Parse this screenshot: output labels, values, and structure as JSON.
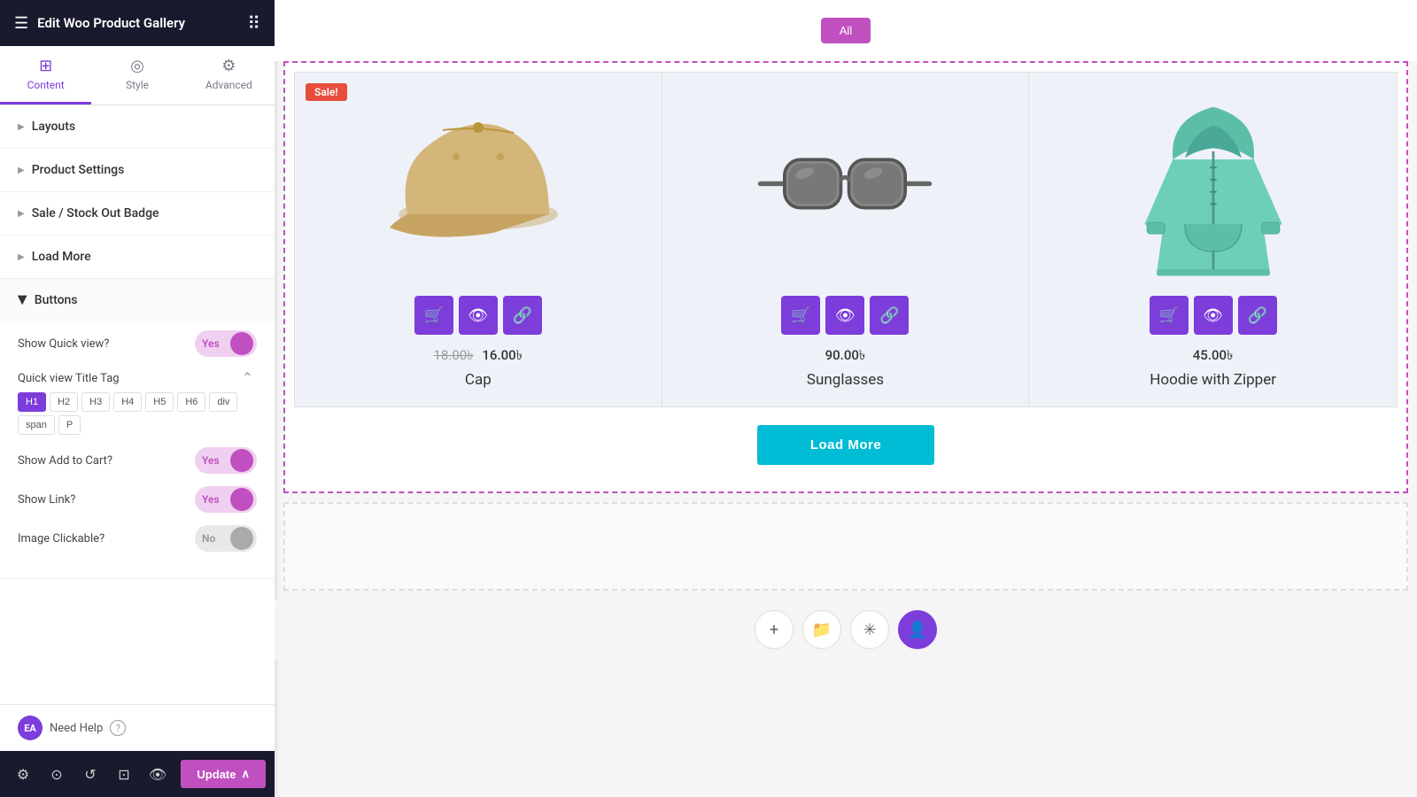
{
  "header": {
    "title": "Edit Woo Product Gallery",
    "hamburger": "☰",
    "dots": "⋮⋮⋮"
  },
  "tabs": [
    {
      "id": "content",
      "label": "Content",
      "icon": "⊞",
      "active": true
    },
    {
      "id": "style",
      "label": "Style",
      "icon": "◎",
      "active": false
    },
    {
      "id": "advanced",
      "label": "Advanced",
      "icon": "⚙",
      "active": false
    }
  ],
  "sections": [
    {
      "id": "layouts",
      "label": "Layouts",
      "expanded": false
    },
    {
      "id": "product-settings",
      "label": "Product Settings",
      "expanded": false
    },
    {
      "id": "sale-badge",
      "label": "Sale / Stock Out Badge",
      "expanded": false
    },
    {
      "id": "load-more",
      "label": "Load More",
      "expanded": false
    },
    {
      "id": "buttons",
      "label": "Buttons",
      "expanded": true
    }
  ],
  "buttons_section": {
    "show_quick_view_label": "Show Quick view?",
    "show_quick_view_value": "Yes",
    "show_quick_view_on": true,
    "quick_view_title_tag_label": "Quick view Title Tag",
    "tag_options": [
      "H1",
      "H2",
      "H3",
      "H4",
      "H5",
      "H6",
      "div",
      "span",
      "P"
    ],
    "active_tag": "H1",
    "show_add_to_cart_label": "Show Add to Cart?",
    "show_add_to_cart_value": "Yes",
    "show_add_to_cart_on": true,
    "show_link_label": "Show Link?",
    "show_link_value": "Yes",
    "show_link_on": true,
    "image_clickable_label": "Image Clickable?",
    "image_clickable_value": "No",
    "image_clickable_on": false
  },
  "footer": {
    "badge_text": "EA",
    "help_text": "Need Help",
    "question_mark": "?"
  },
  "bottom_toolbar": {
    "tools": [
      "⚙",
      "⊙",
      "↺",
      "⊡",
      "👁"
    ],
    "update_label": "Update",
    "chevron": "∧"
  },
  "filter_bar": {
    "buttons": [
      "All"
    ],
    "active": "All"
  },
  "products": [
    {
      "id": "cap",
      "name": "Cap",
      "price_old": "18.00৳",
      "price_new": "16.00৳",
      "has_sale": true,
      "sale_label": "Sale!"
    },
    {
      "id": "sunglasses",
      "name": "Sunglasses",
      "price": "90.00৳",
      "has_sale": false
    },
    {
      "id": "hoodie",
      "name": "Hoodie with Zipper",
      "price": "45.00৳",
      "has_sale": false
    }
  ],
  "action_icons": {
    "cart": "🛒",
    "eye": "👁",
    "link": "🔗"
  },
  "load_more": {
    "label": "Load More"
  },
  "canvas_tools": {
    "plus": "+",
    "folder": "📁",
    "asterisk": "✳",
    "person": "👤"
  }
}
